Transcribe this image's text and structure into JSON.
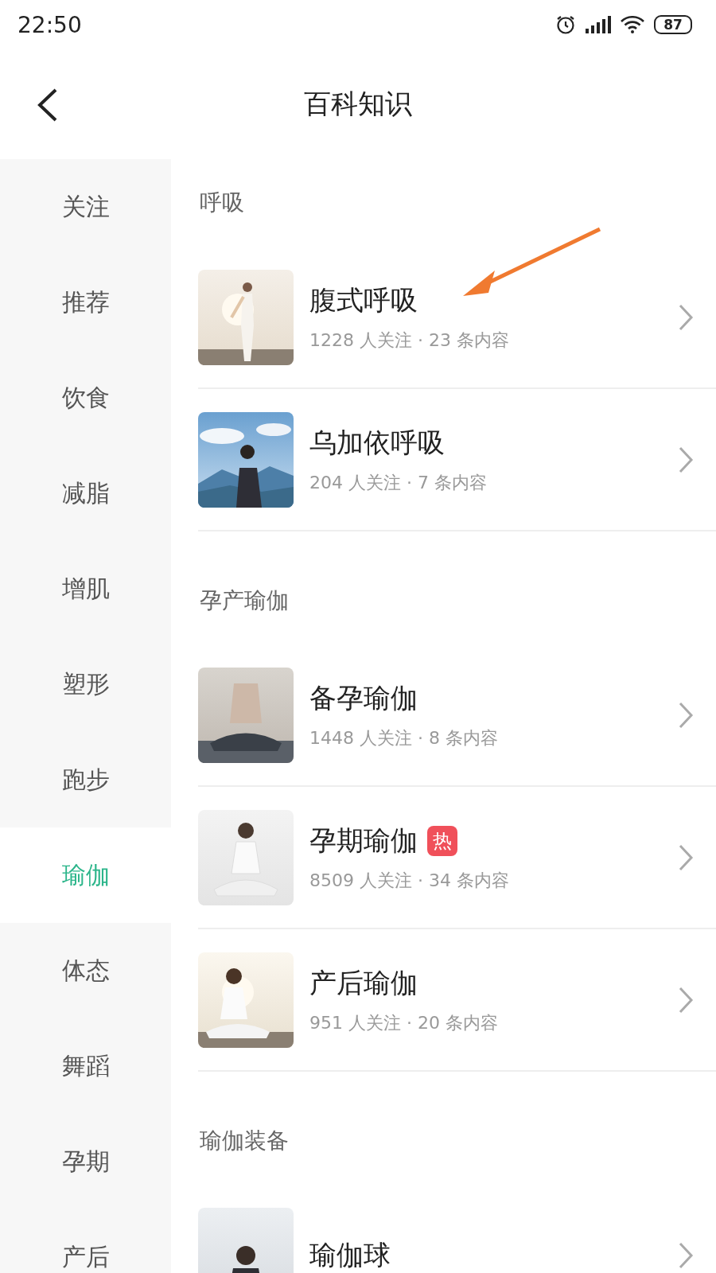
{
  "status_bar": {
    "time": "22:50",
    "battery": "87"
  },
  "header": {
    "title": "百科知识"
  },
  "sidebar": {
    "items": [
      {
        "label": "关注",
        "selected": false
      },
      {
        "label": "推荐",
        "selected": false
      },
      {
        "label": "饮食",
        "selected": false
      },
      {
        "label": "减脂",
        "selected": false
      },
      {
        "label": "增肌",
        "selected": false
      },
      {
        "label": "塑形",
        "selected": false
      },
      {
        "label": "跑步",
        "selected": false
      },
      {
        "label": "瑜伽",
        "selected": true
      },
      {
        "label": "体态",
        "selected": false
      },
      {
        "label": "舞蹈",
        "selected": false
      },
      {
        "label": "孕期",
        "selected": false
      },
      {
        "label": "产后",
        "selected": false
      }
    ]
  },
  "sections": [
    {
      "title": "呼吸",
      "topics": [
        {
          "name": "腹式呼吸",
          "stats": "1228 人关注 · 23 条内容"
        },
        {
          "name": "乌加依呼吸",
          "stats": "204 人关注 · 7 条内容"
        }
      ]
    },
    {
      "title": "孕产瑜伽",
      "topics": [
        {
          "name": "备孕瑜伽",
          "stats": "1448 人关注 · 8 条内容"
        },
        {
          "name": "孕期瑜伽",
          "badge": "热",
          "stats": "8509 人关注 · 34 条内容"
        },
        {
          "name": "产后瑜伽",
          "stats": "951 人关注 · 20 条内容"
        }
      ]
    },
    {
      "title": "瑜伽装备",
      "topics": [
        {
          "name": "瑜伽球"
        }
      ]
    }
  ]
}
